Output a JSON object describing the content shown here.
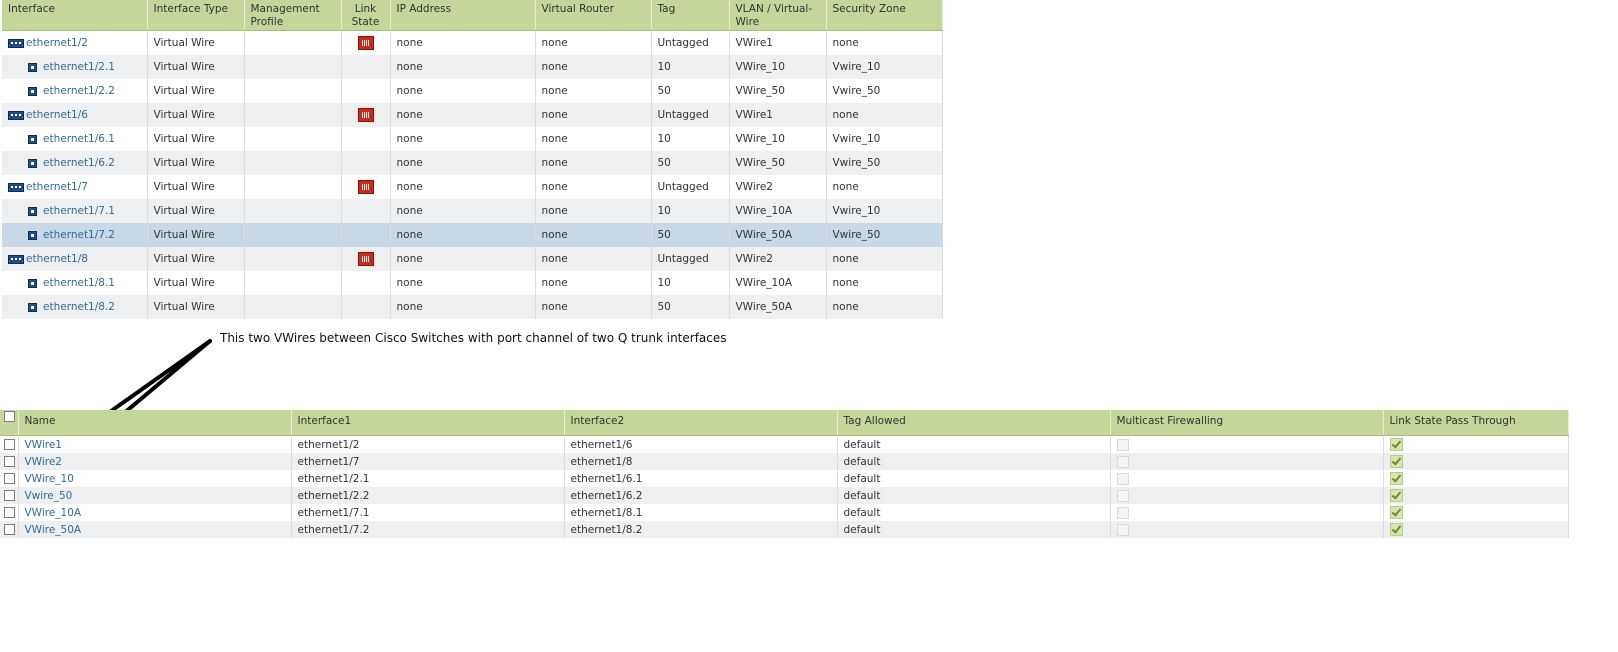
{
  "interfaces_table": {
    "headers": [
      "Interface",
      "Interface Type",
      "Management Profile",
      "Link State",
      "IP Address",
      "Virtual Router",
      "Tag",
      "VLAN / Virtual-Wire",
      "Security Zone"
    ],
    "rows": [
      {
        "interface": "ethernet1/2",
        "type": "Virtual Wire",
        "mgmt": "",
        "link_icon": true,
        "ip": "none",
        "vr": "none",
        "tag": "Untagged",
        "vlan": "VWire1",
        "zone": "none",
        "level": "parent"
      },
      {
        "interface": "ethernet1/2.1",
        "type": "Virtual Wire",
        "mgmt": "",
        "link_icon": false,
        "ip": "none",
        "vr": "none",
        "tag": "10",
        "vlan": "VWire_10",
        "zone": "Vwire_10",
        "level": "sub"
      },
      {
        "interface": "ethernet1/2.2",
        "type": "Virtual Wire",
        "mgmt": "",
        "link_icon": false,
        "ip": "none",
        "vr": "none",
        "tag": "50",
        "vlan": "VWire_50",
        "zone": "Vwire_50",
        "level": "sub"
      },
      {
        "interface": "ethernet1/6",
        "type": "Virtual Wire",
        "mgmt": "",
        "link_icon": true,
        "ip": "none",
        "vr": "none",
        "tag": "Untagged",
        "vlan": "VWire1",
        "zone": "none",
        "level": "parent"
      },
      {
        "interface": "ethernet1/6.1",
        "type": "Virtual Wire",
        "mgmt": "",
        "link_icon": false,
        "ip": "none",
        "vr": "none",
        "tag": "10",
        "vlan": "VWire_10",
        "zone": "Vwire_10",
        "level": "sub"
      },
      {
        "interface": "ethernet1/6.2",
        "type": "Virtual Wire",
        "mgmt": "",
        "link_icon": false,
        "ip": "none",
        "vr": "none",
        "tag": "50",
        "vlan": "VWire_50",
        "zone": "Vwire_50",
        "level": "sub"
      },
      {
        "interface": "ethernet1/7",
        "type": "Virtual Wire",
        "mgmt": "",
        "link_icon": true,
        "ip": "none",
        "vr": "none",
        "tag": "Untagged",
        "vlan": "VWire2",
        "zone": "none",
        "level": "parent"
      },
      {
        "interface": "ethernet1/7.1",
        "type": "Virtual Wire",
        "mgmt": "",
        "link_icon": false,
        "ip": "none",
        "vr": "none",
        "tag": "10",
        "vlan": "VWire_10A",
        "zone": "Vwire_10",
        "level": "sub"
      },
      {
        "interface": "ethernet1/7.2",
        "type": "Virtual Wire",
        "mgmt": "",
        "link_icon": false,
        "ip": "none",
        "vr": "none",
        "tag": "50",
        "vlan": "VWire_50A",
        "zone": "Vwire_50",
        "level": "sub",
        "selected": true
      },
      {
        "interface": "ethernet1/8",
        "type": "Virtual Wire",
        "mgmt": "",
        "link_icon": true,
        "ip": "none",
        "vr": "none",
        "tag": "Untagged",
        "vlan": "VWire2",
        "zone": "none",
        "level": "parent"
      },
      {
        "interface": "ethernet1/8.1",
        "type": "Virtual Wire",
        "mgmt": "",
        "link_icon": false,
        "ip": "none",
        "vr": "none",
        "tag": "10",
        "vlan": "VWire_10A",
        "zone": "none",
        "level": "sub"
      },
      {
        "interface": "ethernet1/8.2",
        "type": "Virtual Wire",
        "mgmt": "",
        "link_icon": false,
        "ip": "none",
        "vr": "none",
        "tag": "50",
        "vlan": "VWire_50A",
        "zone": "none",
        "level": "sub"
      }
    ]
  },
  "annotation": {
    "text": "This two VWires between Cisco Switches with port channel of two Q trunk interfaces"
  },
  "vwire_table": {
    "headers": [
      "Name",
      "Interface1",
      "Interface2",
      "Tag Allowed",
      "Multicast Firewalling",
      "Link State Pass Through"
    ],
    "rows": [
      {
        "name": "VWire1",
        "if1": "ethernet1/2",
        "if2": "ethernet1/6",
        "tag": "default",
        "multicast": false,
        "pass_through": true
      },
      {
        "name": "VWire2",
        "if1": "ethernet1/7",
        "if2": "ethernet1/8",
        "tag": "default",
        "multicast": false,
        "pass_through": true
      },
      {
        "name": "VWire_10",
        "if1": "ethernet1/2.1",
        "if2": "ethernet1/6.1",
        "tag": "default",
        "multicast": false,
        "pass_through": true
      },
      {
        "name": "Vwire_50",
        "if1": "ethernet1/2.2",
        "if2": "ethernet1/6.2",
        "tag": "default",
        "multicast": false,
        "pass_through": true
      },
      {
        "name": "VWire_10A",
        "if1": "ethernet1/7.1",
        "if2": "ethernet1/8.1",
        "tag": "default",
        "multicast": false,
        "pass_through": true
      },
      {
        "name": "VWire_50A",
        "if1": "ethernet1/7.2",
        "if2": "ethernet1/8.2",
        "tag": "default",
        "multicast": false,
        "pass_through": true
      }
    ]
  },
  "colors": {
    "header_bg": "#c5d69b",
    "link_text": "#2e6c9c",
    "selected_row": "#c7d9e6",
    "link_state_down": "#cc2a1a"
  }
}
